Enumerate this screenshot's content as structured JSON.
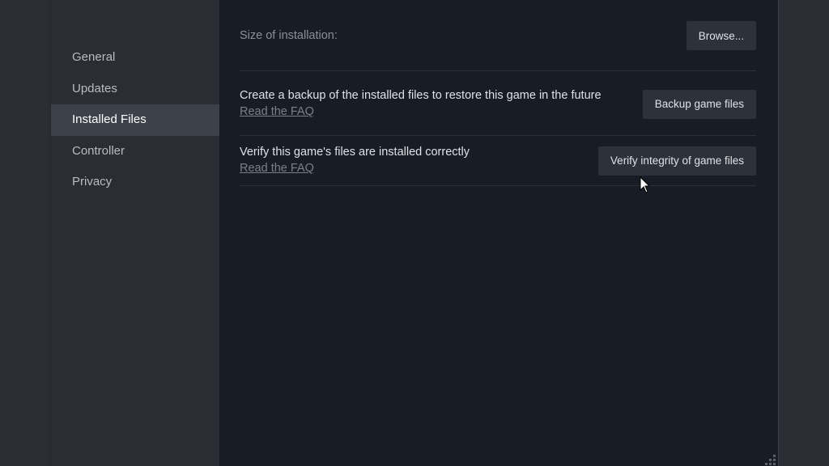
{
  "sidebar": {
    "items": [
      {
        "label": "General",
        "active": false
      },
      {
        "label": "Updates",
        "active": false
      },
      {
        "label": "Installed Files",
        "active": true
      },
      {
        "label": "Controller",
        "active": false
      },
      {
        "label": "Privacy",
        "active": false
      }
    ]
  },
  "main": {
    "size_label": "Size of installation:",
    "browse_label": "Browse...",
    "backup": {
      "description": "Create a backup of the installed files to restore this game in the future",
      "faq_link": "Read the FAQ",
      "button_label": "Backup game files"
    },
    "verify": {
      "description": "Verify this game's files are installed correctly",
      "faq_link": "Read the FAQ",
      "button_label": "Verify integrity of game files"
    }
  },
  "colors": {
    "sidebar_bg": "#2a2d33",
    "sidebar_active_bg": "#3d4149",
    "content_bg": "#181c25",
    "button_bg": "#2d313a"
  }
}
